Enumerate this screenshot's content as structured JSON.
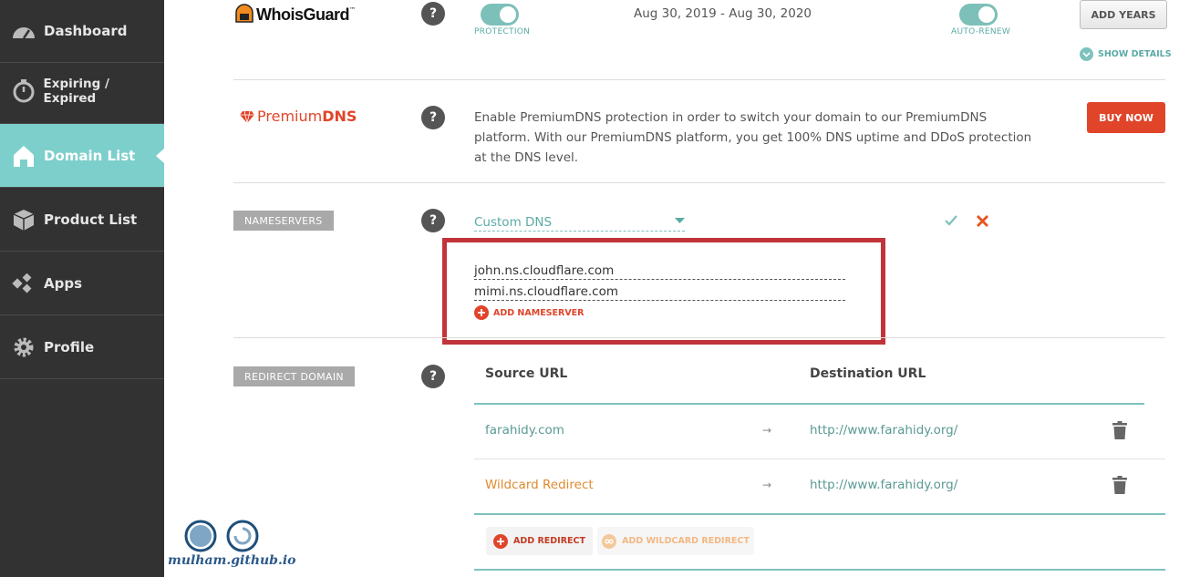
{
  "sidebar": {
    "items": [
      {
        "label": "Dashboard",
        "icon": "speedometer-icon"
      },
      {
        "label": "Expiring / Expired",
        "icon": "stopwatch-icon"
      },
      {
        "label": "Domain List",
        "icon": "home-icon",
        "active": true
      },
      {
        "label": "Product List",
        "icon": "box-icon"
      },
      {
        "label": "Apps",
        "icon": "apps-icon"
      },
      {
        "label": "Profile",
        "icon": "gear-icon"
      }
    ]
  },
  "whoisguard": {
    "logo_text": "WhoisGuard",
    "logo_tm": "™",
    "protection_label": "PROTECTION",
    "dates": "Aug 30, 2019 - Aug 30, 2020",
    "autorenew_label": "AUTO-RENEW",
    "add_years": "ADD YEARS",
    "show_details": "SHOW DETAILS"
  },
  "premiumdns": {
    "logo_text_a": "Premium",
    "logo_text_b": "DNS",
    "description_lines": [
      "Enable PremiumDNS protection in order to switch your domain to our PremiumDNS",
      "platform. With our PremiumDNS platform, you get 100% DNS uptime and DDoS protection",
      "at the DNS level."
    ],
    "buy_now": "BUY NOW"
  },
  "nameservers": {
    "tag": "NAMESERVERS",
    "select_value": "Custom DNS",
    "servers": [
      "john.ns.cloudflare.com",
      "mimi.ns.cloudflare.com"
    ],
    "add_label": "ADD NAMESERVER"
  },
  "redirect": {
    "tag": "REDIRECT DOMAIN",
    "source_header": "Source URL",
    "dest_header": "Destination URL",
    "rows": [
      {
        "source": "farahidy.com",
        "arrow": "→",
        "dest": "http://www.farahidy.org/"
      },
      {
        "source": "Wildcard Redirect",
        "arrow": "→",
        "dest": "http://www.farahidy.org/"
      }
    ],
    "add_redirect": "ADD REDIRECT",
    "add_wildcard": "ADD WILDCARD REDIRECT"
  },
  "help_glyph": "?",
  "watermark": "mulham.github.io",
  "colors": {
    "accent": "#7dcfcb",
    "danger": "#e0452a",
    "sidebar": "#323232",
    "wildcard": "#e08a2e"
  }
}
